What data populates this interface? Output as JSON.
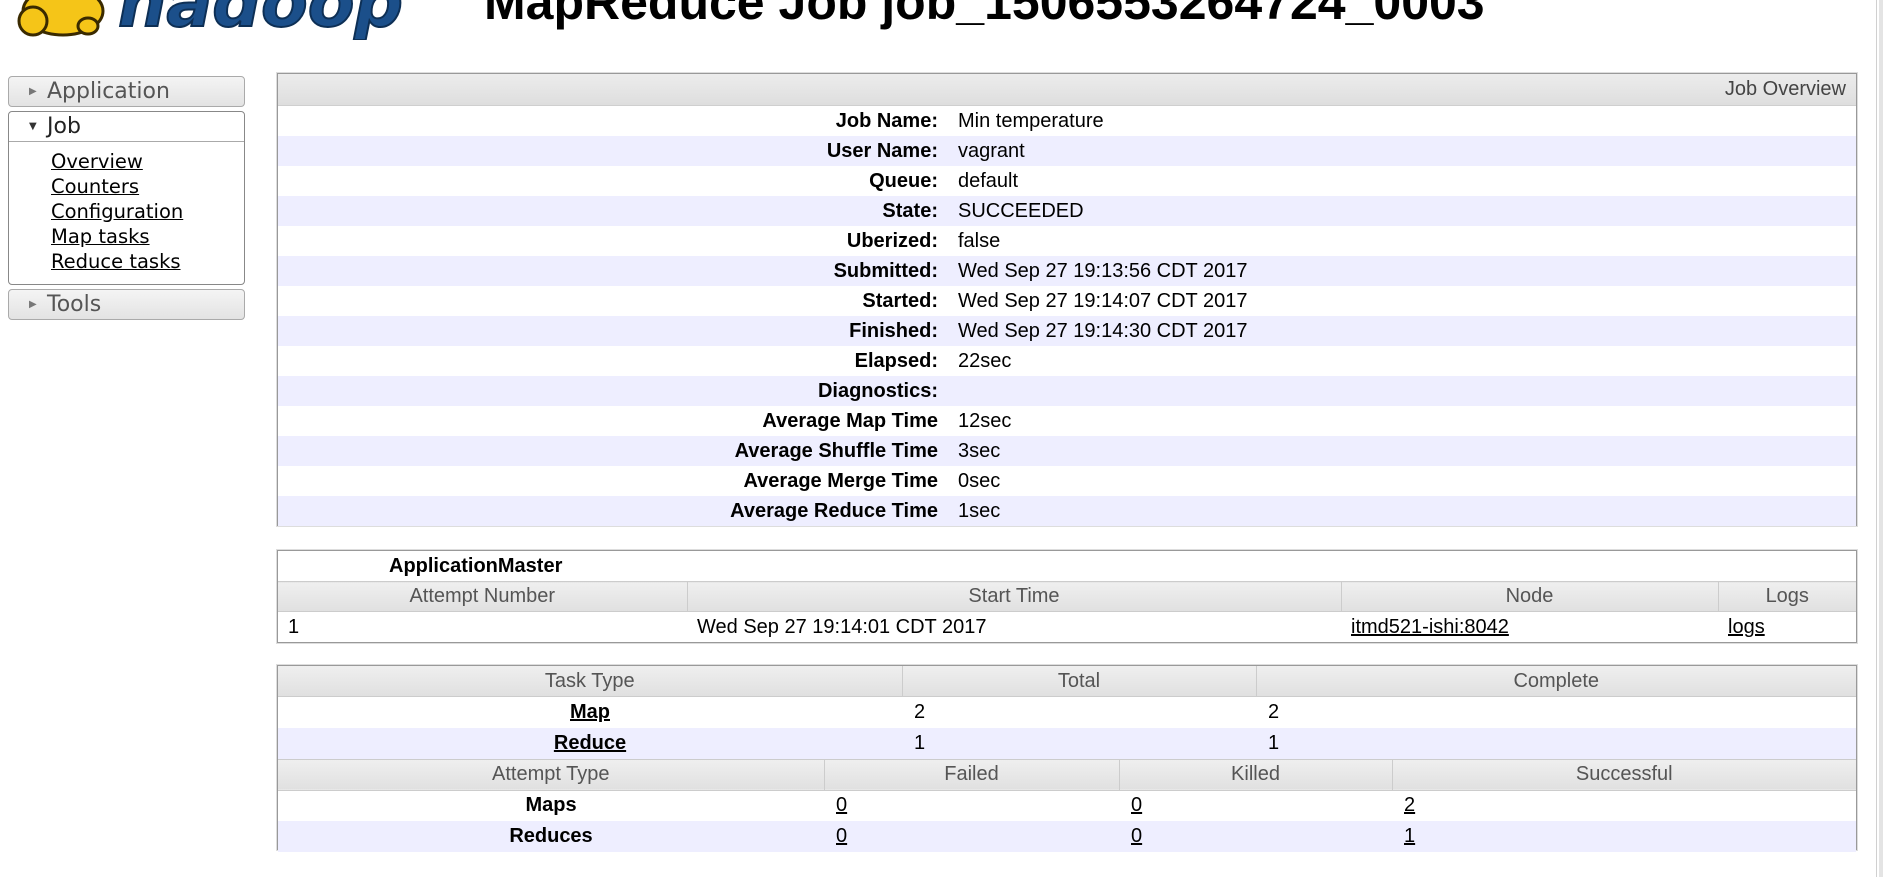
{
  "header": {
    "title": "MapReduce Job job_1506553264724_0003",
    "logo_text": "hadoop"
  },
  "nav": {
    "application": "Application",
    "job": "Job",
    "job_items": [
      "Overview",
      "Counters",
      "Configuration",
      "Map tasks",
      "Reduce tasks"
    ],
    "tools": "Tools"
  },
  "overview": {
    "heading": "Job Overview",
    "rows": [
      {
        "label": "Job Name:",
        "value": "Min temperature"
      },
      {
        "label": "User Name:",
        "value": "vagrant"
      },
      {
        "label": "Queue:",
        "value": "default"
      },
      {
        "label": "State:",
        "value": "SUCCEEDED"
      },
      {
        "label": "Uberized:",
        "value": "false"
      },
      {
        "label": "Submitted:",
        "value": "Wed Sep 27 19:13:56 CDT 2017"
      },
      {
        "label": "Started:",
        "value": "Wed Sep 27 19:14:07 CDT 2017"
      },
      {
        "label": "Finished:",
        "value": "Wed Sep 27 19:14:30 CDT 2017"
      },
      {
        "label": "Elapsed:",
        "value": "22sec"
      },
      {
        "label": "Diagnostics:",
        "value": ""
      },
      {
        "label": "Average Map Time",
        "value": "12sec"
      },
      {
        "label": "Average Shuffle Time",
        "value": "3sec"
      },
      {
        "label": "Average Merge Time",
        "value": "0sec"
      },
      {
        "label": "Average Reduce Time",
        "value": "1sec"
      }
    ]
  },
  "application_master": {
    "title": "ApplicationMaster",
    "columns": [
      "Attempt Number",
      "Start Time",
      "Node",
      "Logs"
    ],
    "row": {
      "attempt": "1",
      "start_time": "Wed Sep 27 19:14:01 CDT 2017",
      "node": "itmd521-ishi:8042",
      "logs": "logs"
    }
  },
  "tasks": {
    "task_columns": [
      "Task Type",
      "Total",
      "Complete"
    ],
    "task_rows": [
      {
        "type": "Map",
        "total": "2",
        "complete": "2"
      },
      {
        "type": "Reduce",
        "total": "1",
        "complete": "1"
      }
    ],
    "attempt_columns": [
      "Attempt Type",
      "Failed",
      "Killed",
      "Successful"
    ],
    "attempt_rows": [
      {
        "type": "Maps",
        "failed": "0",
        "killed": "0",
        "successful": "2"
      },
      {
        "type": "Reduces",
        "failed": "0",
        "killed": "0",
        "successful": "1"
      }
    ]
  },
  "colors": {
    "row_alt": "#eeeeff",
    "logo_yellow": "#f5c518",
    "logo_blue": "#1b4f8a"
  }
}
